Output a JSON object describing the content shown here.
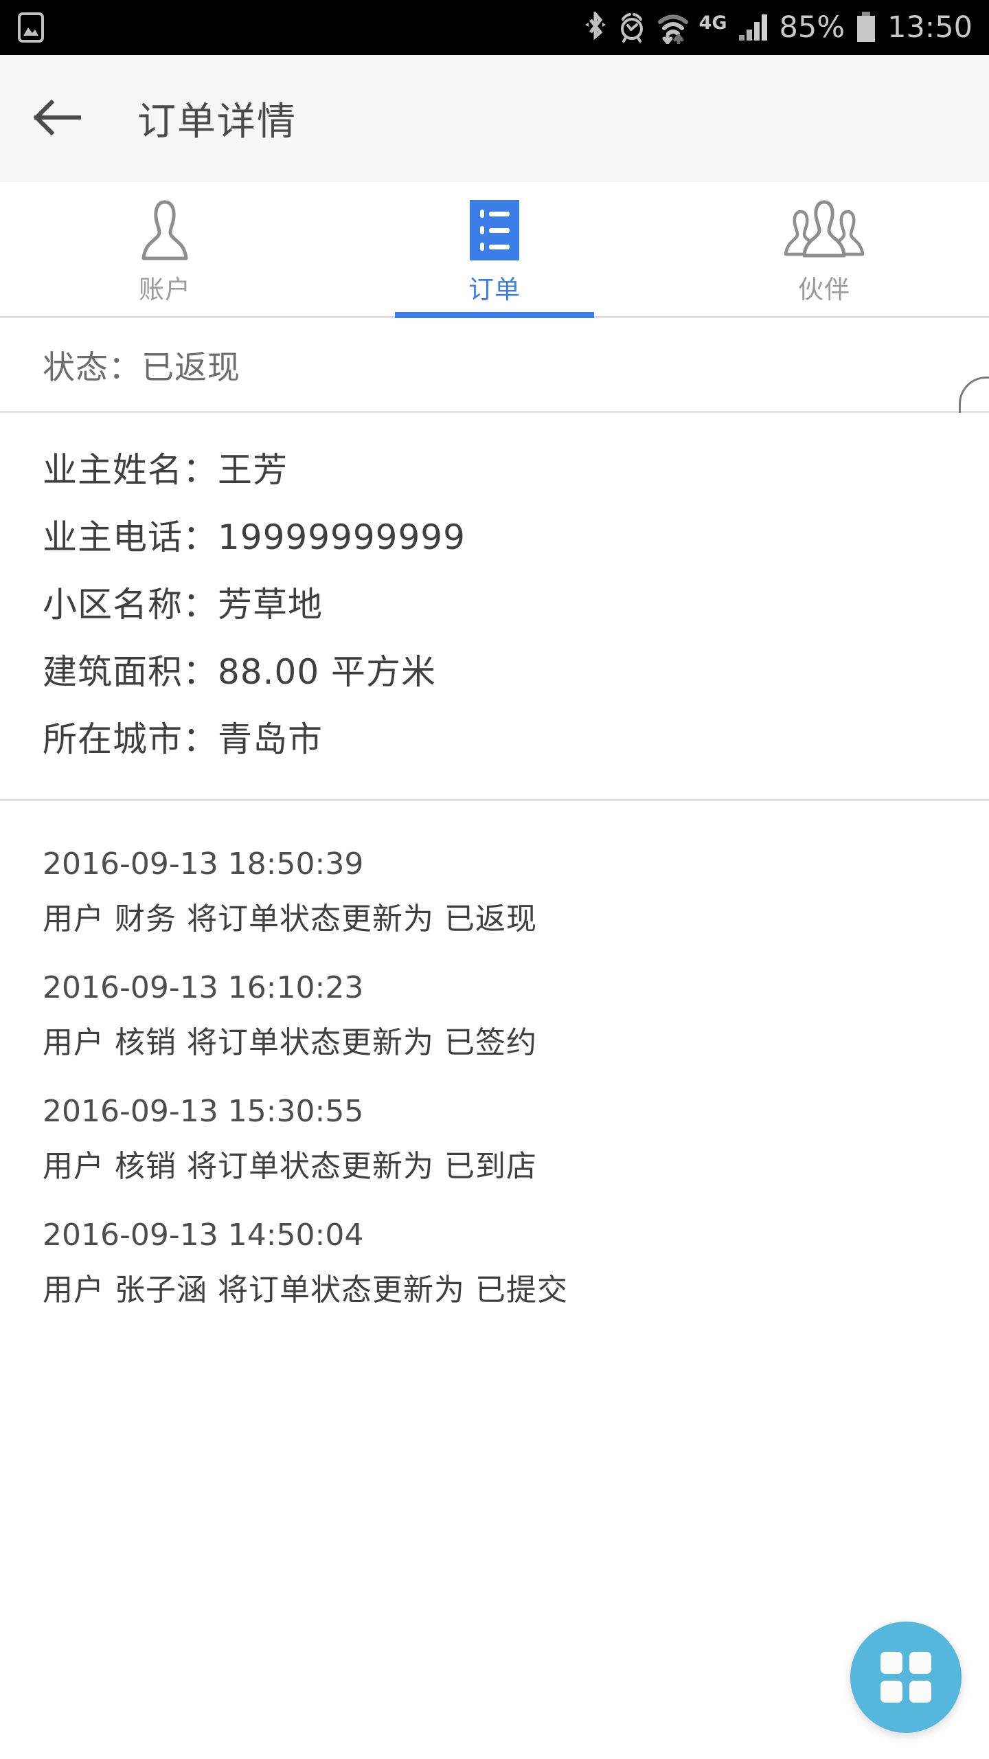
{
  "status_bar": {
    "notification_icon": "image-icon",
    "bluetooth_icon": "bluetooth-icon",
    "alarm_icon": "alarm-clock-icon",
    "wifi_icon": "wifi-icon",
    "network_type": "4G",
    "signal_icon": "cellular-signal-icon",
    "battery_percent": "85%",
    "battery_icon": "battery-icon",
    "time": "13:50"
  },
  "app_bar": {
    "back_icon": "back-arrow-icon",
    "title": "订单详情"
  },
  "tabs": [
    {
      "label": "账户",
      "icon": "person-icon",
      "active": false
    },
    {
      "label": "订单",
      "icon": "list-icon",
      "active": true
    },
    {
      "label": "伙伴",
      "icon": "people-group-icon",
      "active": false
    }
  ],
  "content": {
    "status_line": "状态：已返现",
    "info_rows": [
      "业主姓名：王芳",
      "业主电话：19999999999",
      "小区名称：芳草地",
      "建筑面积：88.00 平方米",
      "所在城市：青岛市"
    ],
    "log_entries": [
      {
        "time": "2016-09-13 18:50:39",
        "desc": "用户 财务 将订单状态更新为 已返现"
      },
      {
        "time": "2016-09-13 16:10:23",
        "desc": "用户 核销 将订单状态更新为 已签约"
      },
      {
        "time": "2016-09-13 15:30:55",
        "desc": "用户 核销 将订单状态更新为 已到店"
      },
      {
        "time": "2016-09-13 14:50:04",
        "desc": "用户 张子涵 将订单状态更新为 已提交"
      }
    ]
  },
  "fab": {
    "icon": "grid-apps-icon",
    "color": "#56b7dc"
  },
  "colors": {
    "accent": "#3b7ee8",
    "app_bar_bg": "#f7f7f7",
    "text_primary": "#3f3f3f",
    "text_secondary": "#6d6d6d",
    "tab_inactive": "#9b9b9b",
    "fab": "#56b7dc",
    "divider": "#e3e3e3"
  }
}
